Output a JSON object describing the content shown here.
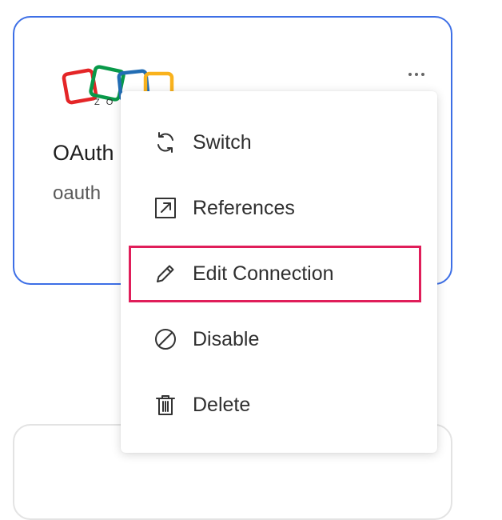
{
  "connection": {
    "name": "OAuth",
    "subtitle": "oauth",
    "logo_text": "ZO",
    "more_label": "More options"
  },
  "menu": {
    "items": [
      {
        "label": "Switch",
        "icon": "refresh-icon"
      },
      {
        "label": "References",
        "icon": "external-link-icon"
      },
      {
        "label": "Edit Connection",
        "icon": "pencil-icon"
      },
      {
        "label": "Disable",
        "icon": "disable-icon"
      },
      {
        "label": "Delete",
        "icon": "trash-icon"
      }
    ]
  },
  "colors": {
    "card_border": "#3d6fe6",
    "highlight": "#e01e5a",
    "logo_red": "#e42527",
    "logo_green": "#089949",
    "logo_blue": "#226db4",
    "logo_yellow": "#f9b21d"
  }
}
